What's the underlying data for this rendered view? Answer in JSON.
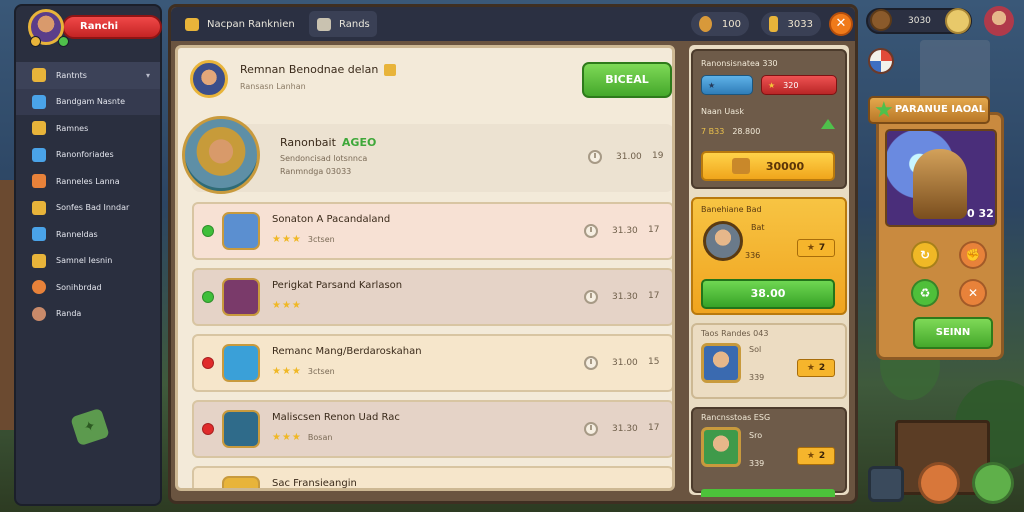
{
  "sidebar": {
    "player_name": "Ranchi",
    "items": [
      {
        "label": "Rantnts",
        "icon": "folder-icon",
        "color": "#e8b43a"
      },
      {
        "label": "Bandgam Nasnte",
        "icon": "monitor-icon",
        "color": "#4aa3e8"
      },
      {
        "label": "Ramnes",
        "icon": "pencil-icon",
        "color": "#e8b43a"
      },
      {
        "label": "Ranonforiades",
        "icon": "document-icon",
        "color": "#4aa3e8"
      },
      {
        "label": "Ranneles Lanna",
        "icon": "chest-icon",
        "color": "#e8823a"
      },
      {
        "label": "Sonfes Bad Inndar",
        "icon": "flag-icon",
        "color": "#e8b43a"
      },
      {
        "label": "Ranneldas",
        "icon": "house-icon",
        "color": "#4aa3e8"
      },
      {
        "label": "Samnel Iesnin",
        "icon": "gears-icon",
        "color": "#e8b43a"
      },
      {
        "label": "Sonihbrdad",
        "icon": "coin-icon",
        "color": "#e8823a"
      },
      {
        "label": "Randa",
        "icon": "helmet-icon",
        "color": "#c98a6a"
      }
    ]
  },
  "topbar": {
    "tab1": "Nacpan Ranknien",
    "tab2": "Rands",
    "currency1": "100",
    "currency2": "3033",
    "close": "✕"
  },
  "profile": {
    "name": "Remnan Benodnae delan",
    "sub": "Ransasn Lanhan",
    "select_button": "BICEAL"
  },
  "featured": {
    "title": "Ranonbait",
    "accent": "AGEO",
    "line1": "Sendoncisad lotsnnca",
    "line2": "Ranmndga 03033",
    "time": "31.00",
    "count": "19"
  },
  "quests": [
    {
      "title": "Sonaton A Pacandaland",
      "stars_label": "3ctsen",
      "time": "31.30",
      "count": "17",
      "dot": "#3fbf3a",
      "bg": "#f7e1d4",
      "avatar_bg": "#5b8fd0"
    },
    {
      "title": "Perigkat Parsand Karlason",
      "stars_label": "",
      "time": "31.30",
      "count": "17",
      "dot": "#3fbf3a",
      "bg": "#e5d3c7",
      "avatar_bg": "#7a3a6a"
    },
    {
      "title": "Remanc Mang/Berdaroskahan",
      "stars_label": "3ctsen",
      "time": "31.00",
      "count": "15",
      "dot": "#e02b2b",
      "bg": "#f6e6cb",
      "avatar_bg": "#3aa0d8"
    },
    {
      "title": "Maliscsen Renon Uad Rac",
      "stars_label": "Bosan",
      "time": "31.30",
      "count": "17",
      "dot": "#e02b2b",
      "bg": "#e5d3c7",
      "avatar_bg": "#2f6b8a"
    },
    {
      "title": "Sac Fransieangin",
      "stars_label": "",
      "time": "",
      "count": "",
      "dot": "",
      "bg": "#f6e6cb",
      "avatar_bg": "#e8b43a"
    }
  ],
  "right": {
    "box1": {
      "title": "Ranonsisnatea 330",
      "pill_red": "320",
      "label": "Naan Uask",
      "stat_key": "7 B33",
      "stat_val": "28.800",
      "gold_button": "30000"
    },
    "box2": {
      "title": "Banehiane Bad",
      "name": "Bat",
      "level": "336",
      "tag": "7",
      "green_button": "38.00"
    },
    "box3": {
      "title": "Taos Randes 043",
      "name": "Sol",
      "level": "339",
      "tag": "2"
    },
    "box4": {
      "title": "Rancnsstoas ESG",
      "name": "Sro",
      "level": "339",
      "tag": "2"
    }
  },
  "hero": {
    "banner": "PARANUE IAOAL",
    "level": "0 32",
    "save_button": "SEINN"
  },
  "hud": {
    "label": "3030"
  },
  "colors": {
    "accent_green": "#45a82b",
    "accent_gold": "#f0a51b",
    "accent_red": "#e02b2b",
    "panel_cream": "#f3ead9"
  }
}
